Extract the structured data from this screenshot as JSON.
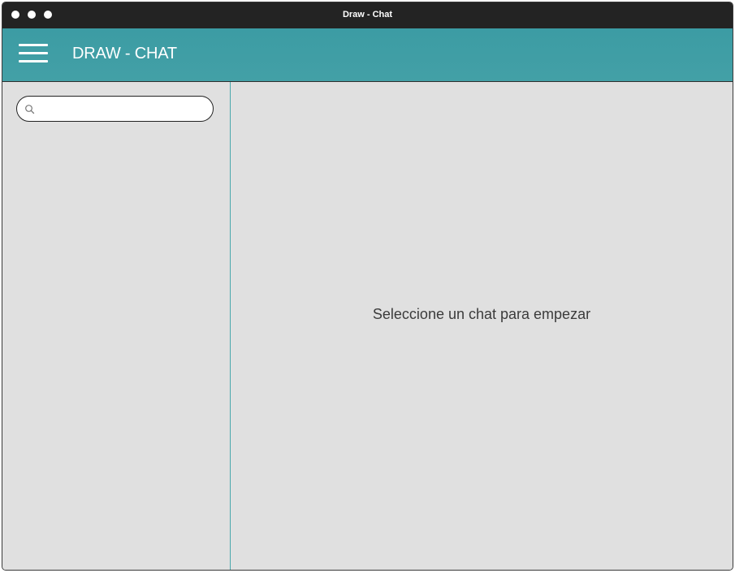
{
  "window": {
    "title": "Draw - Chat"
  },
  "appbar": {
    "title": "DRAW - CHAT",
    "menu_icon": "hamburger-menu-icon",
    "color": "#3f9da4"
  },
  "sidebar": {
    "search": {
      "value": "",
      "placeholder": "",
      "icon": "search-icon"
    }
  },
  "main": {
    "empty_message": "Seleccione un chat para empezar"
  }
}
